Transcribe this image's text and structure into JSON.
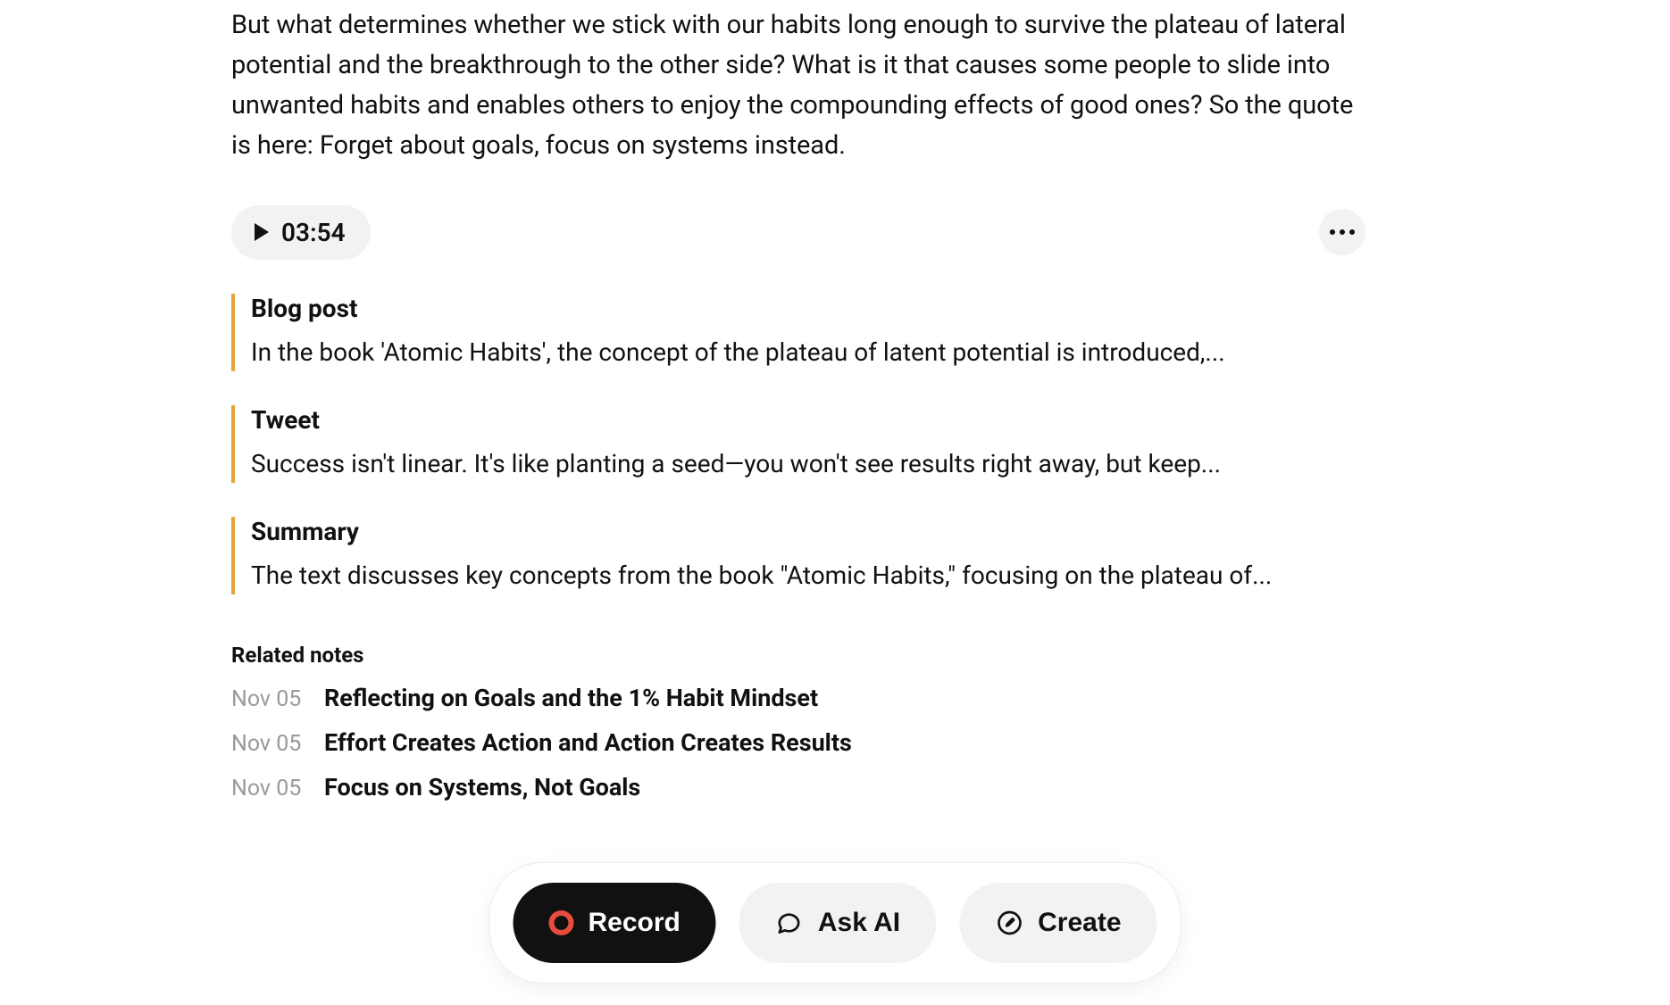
{
  "body_text": "But what determines whether we stick with our habits long enough to survive the plateau of lateral potential and the breakthrough to the other side? What is it that causes some people to slide into unwanted habits and enables others to enjoy the compounding effects of good ones? So the quote is here: Forget about goals, focus on systems instead.",
  "audio": {
    "duration": "03:54"
  },
  "snippets": [
    {
      "title": "Blog post",
      "body": "In the book 'Atomic Habits', the concept of the plateau of latent potential is introduced,..."
    },
    {
      "title": "Tweet",
      "body": "Success isn't linear. It's like planting a seed—you won't see results right away, but keep..."
    },
    {
      "title": "Summary",
      "body": "The text discusses key concepts from the book \"Atomic Habits,\" focusing on the plateau of..."
    }
  ],
  "related": {
    "heading": "Related notes",
    "items": [
      {
        "date": "Nov 05",
        "title": "Reflecting on Goals and the 1% Habit Mindset"
      },
      {
        "date": "Nov 05",
        "title": "Effort Creates Action and Action Creates Results"
      },
      {
        "date": "Nov 05",
        "title": "Focus on Systems, Not Goals"
      }
    ]
  },
  "bottom_bar": {
    "record": "Record",
    "ask_ai": "Ask AI",
    "create": "Create"
  }
}
